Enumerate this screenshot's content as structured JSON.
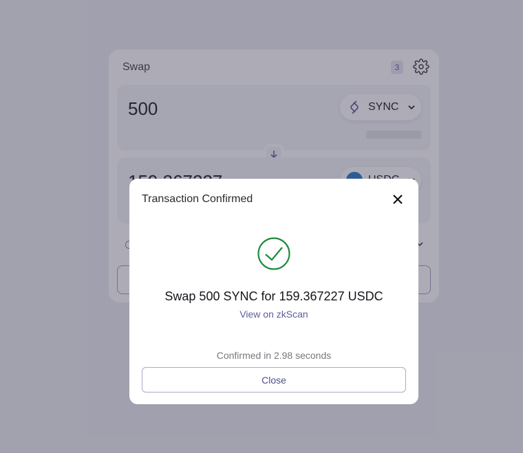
{
  "swap": {
    "title": "Swap",
    "settings_count": "3",
    "from": {
      "amount": "500",
      "token": "SYNC",
      "token_icon": "sync-token-icon"
    },
    "to": {
      "amount": "159.367227",
      "token": "USDC",
      "token_icon": "usdc-token-icon"
    }
  },
  "modal": {
    "title": "Transaction Confirmed",
    "close_icon": "close-icon",
    "status_icon": "check-circle-icon",
    "summary": "Swap 500 SYNC for 159.367227 USDC",
    "link_label": "View on zkScan",
    "confirmed_text": "Confirmed in 2.98 seconds",
    "close_label": "Close"
  },
  "colors": {
    "accent": "#5d5c9e",
    "success": "#1e8a3e",
    "overlay": "#8e8d9b"
  }
}
